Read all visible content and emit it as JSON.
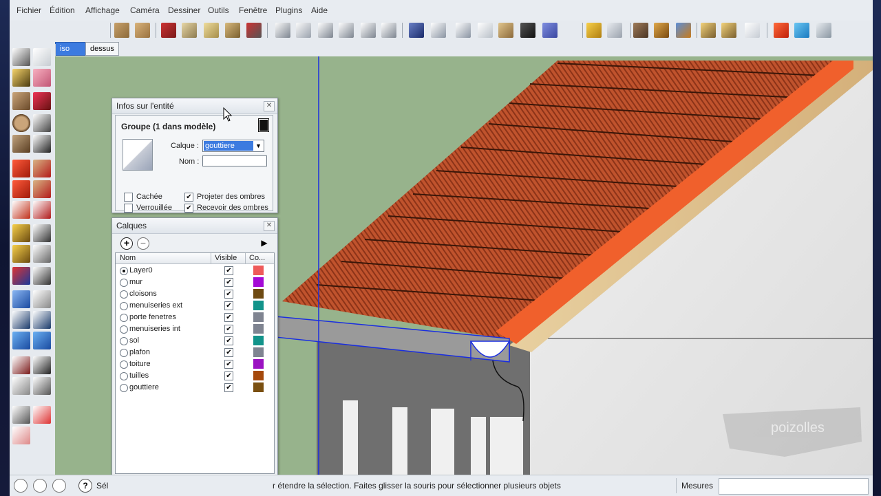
{
  "menus": [
    "Fichier",
    "Édition",
    "Affichage",
    "Caméra",
    "Dessiner",
    "Outils",
    "Fenêtre",
    "Plugins",
    "Aide"
  ],
  "scenes": [
    "iso",
    "dessus"
  ],
  "entity_info": {
    "title": "Infos sur l'entité",
    "header": "Groupe (1 dans modèle)",
    "layer_label": "Calque :",
    "layer_value": "gouttiere",
    "name_label": "Nom :",
    "name_value": "",
    "hidden_label": "Cachée",
    "locked_label": "Verrouillée",
    "cast_shadows_label": "Projeter des ombres",
    "receive_shadows_label": "Recevoir des ombres",
    "hidden": false,
    "locked": false,
    "cast_shadows": true,
    "receive_shadows": true
  },
  "layers_panel": {
    "title": "Calques",
    "col_name": "Nom",
    "col_visible": "Visible",
    "col_color": "Co...",
    "layers": [
      {
        "name": "Layer0",
        "active": true,
        "visible": true,
        "color": "#ee5a5a"
      },
      {
        "name": "mur",
        "active": false,
        "visible": true,
        "color": "#a40ad6"
      },
      {
        "name": "cloisons",
        "active": false,
        "visible": true,
        "color": "#6e4a12"
      },
      {
        "name": "menuiseries ext",
        "active": false,
        "visible": true,
        "color": "#12938a"
      },
      {
        "name": "porte fenetres",
        "active": false,
        "visible": true,
        "color": "#7f8491"
      },
      {
        "name": "menuiseries int",
        "active": false,
        "visible": true,
        "color": "#7f8491"
      },
      {
        "name": "sol",
        "active": false,
        "visible": true,
        "color": "#12938a"
      },
      {
        "name": "plafon",
        "active": false,
        "visible": true,
        "color": "#7f8491"
      },
      {
        "name": "toiture",
        "active": false,
        "visible": true,
        "color": "#9b12c2"
      },
      {
        "name": "tuilles",
        "active": false,
        "visible": true,
        "color": "#a5490c"
      },
      {
        "name": "gouttiere",
        "active": false,
        "visible": true,
        "color": "#7a4f10"
      }
    ]
  },
  "status": {
    "prefix": "Sél",
    "message": "r étendre la sélection. Faites glisser la souris pour sélectionner plusieurs objets",
    "measures_label": "Mesures"
  },
  "watermark": "poizolles"
}
